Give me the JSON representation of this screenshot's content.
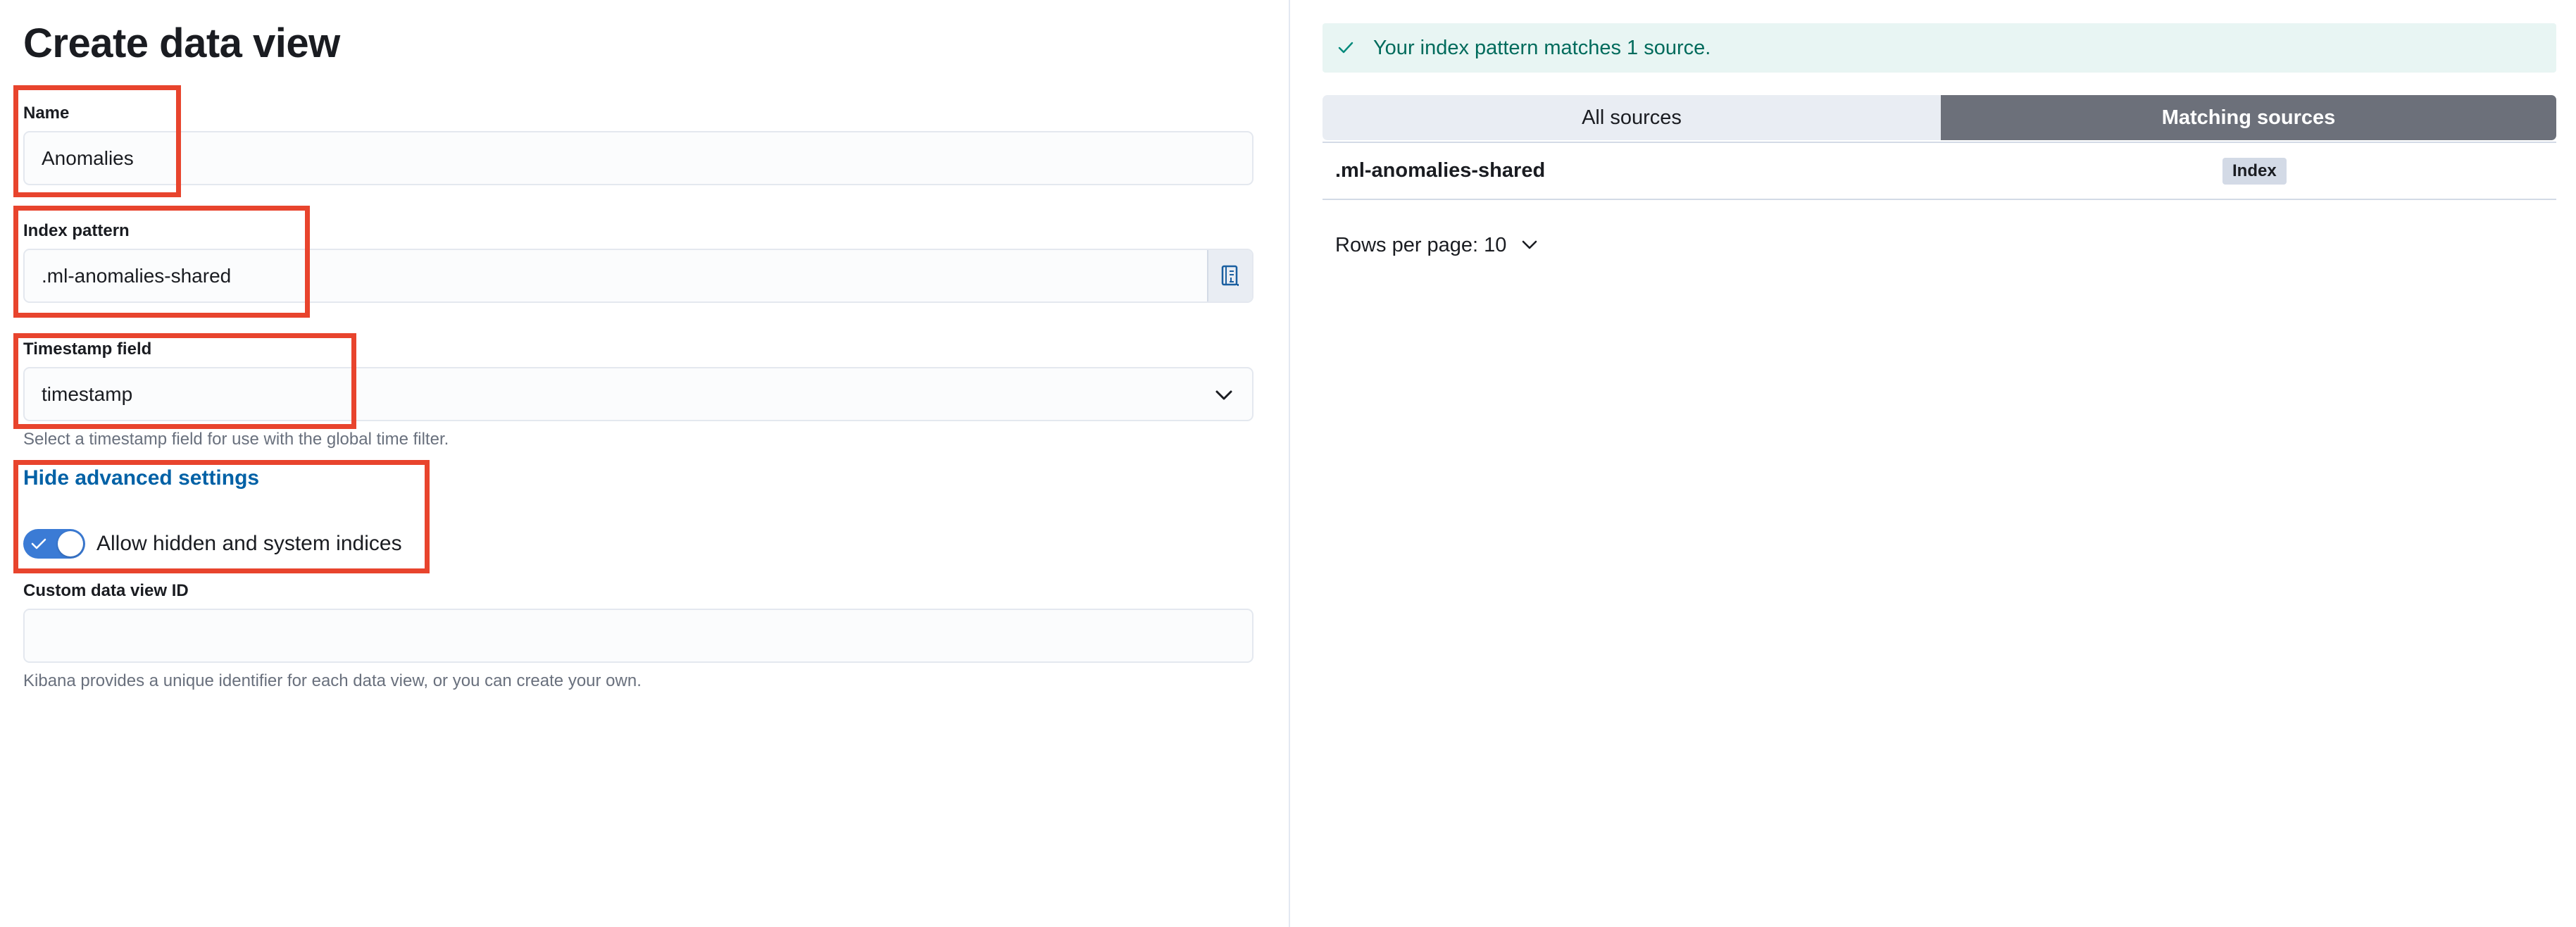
{
  "page": {
    "title": "Create data view"
  },
  "form": {
    "name": {
      "label": "Name",
      "value": "Anomalies"
    },
    "index_pattern": {
      "label": "Index pattern",
      "value": ".ml-anomalies-shared",
      "append_icon": "index-mapping-icon"
    },
    "timestamp": {
      "label": "Timestamp field",
      "value": "timestamp",
      "help": "Select a timestamp field for use with the global time filter.",
      "icon": "chevron-down-icon"
    },
    "advanced_link": "Hide advanced settings",
    "allow_hidden": {
      "label": "Allow hidden and system indices",
      "checked": true
    },
    "custom_id": {
      "label": "Custom data view ID",
      "value": "",
      "help": "Kibana provides a unique identifier for each data view, or you can create your own."
    }
  },
  "results": {
    "callout": "Your index pattern matches 1 source.",
    "tabs": {
      "all": "All sources",
      "matching": "Matching sources",
      "selected": "matching"
    },
    "rows": [
      {
        "name": ".ml-anomalies-shared",
        "type": "Index"
      }
    ],
    "rows_per_page": "Rows per page: 10"
  },
  "colors": {
    "highlight_border": "#e8442d",
    "link": "#0061a6",
    "toggle_on": "#3b7bd5",
    "success_text": "#006b5c",
    "success_bg": "#e8f5f3",
    "selected_tab_bg": "#6c707a"
  }
}
